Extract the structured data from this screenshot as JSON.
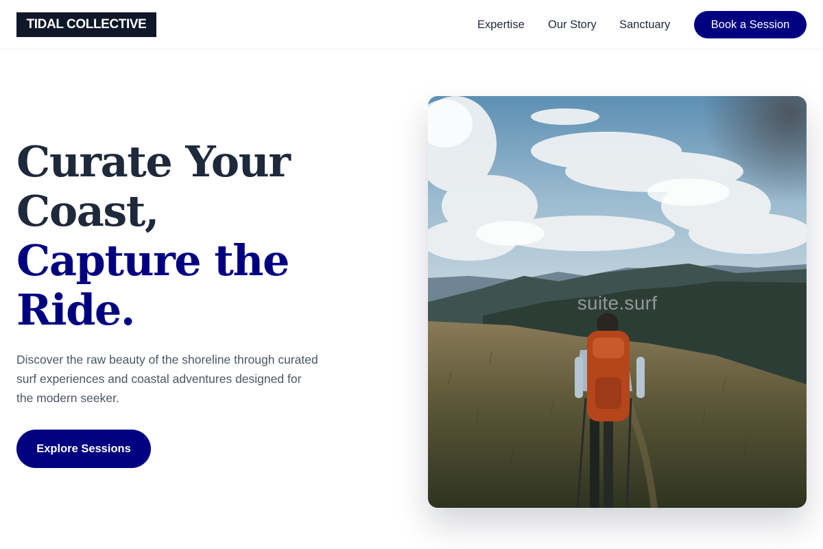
{
  "header": {
    "logo": "TIDAL COLLECTIVE",
    "nav": [
      {
        "label": "Expertise"
      },
      {
        "label": "Our Story"
      },
      {
        "label": "Sanctuary"
      }
    ],
    "cta": "Book a Session"
  },
  "hero": {
    "headline_line1": "Curate Your",
    "headline_line2": "Coast,",
    "headline_line3": "Capture the",
    "headline_line4": "Ride.",
    "description": "Discover the raw beauty of the shoreline through curated surf experiences and coastal adventures designed for the modern seeker.",
    "cta": "Explore Sessions",
    "image_watermark": "suite.surf"
  },
  "colors": {
    "brand_navy": "#000080",
    "logo_bg": "#0f1729",
    "text_dark": "#1e293b",
    "text_muted": "#4b5563"
  }
}
